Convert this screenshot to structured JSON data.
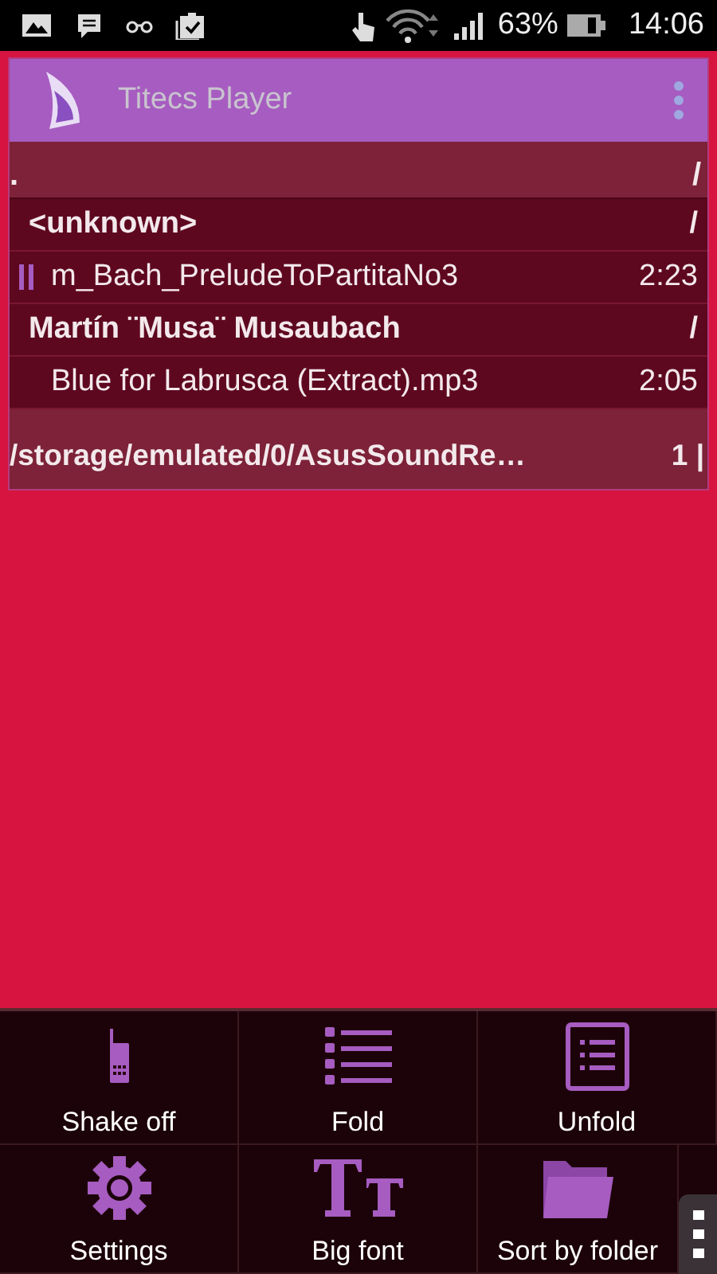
{
  "status_bar": {
    "battery": "63%",
    "time": "14:06"
  },
  "app": {
    "title": "Titecs Player"
  },
  "list": {
    "header": {
      "name": ".",
      "mark": "/"
    },
    "rows": [
      {
        "kind": "folder",
        "name": "<unknown>",
        "right": "/"
      },
      {
        "kind": "track",
        "name": "m_Bach_PreludeToPartitaNo3",
        "right": "2:23",
        "playing": true
      },
      {
        "kind": "folder",
        "name": "Martín ¨Musa¨ Musaubach",
        "right": "/"
      },
      {
        "kind": "track",
        "name": "Blue for Labrusca (Extract).mp3",
        "right": "2:05",
        "playing": false
      }
    ],
    "footer": {
      "path": "/storage/emulated/0/AsusSoundRe…",
      "count": "1 |"
    }
  },
  "menu": {
    "items": [
      {
        "label": "Shake off"
      },
      {
        "label": "Fold"
      },
      {
        "label": "Unfold"
      },
      {
        "label": "Settings"
      },
      {
        "label": "Big font"
      },
      {
        "label": "Sort by folder"
      }
    ]
  }
}
